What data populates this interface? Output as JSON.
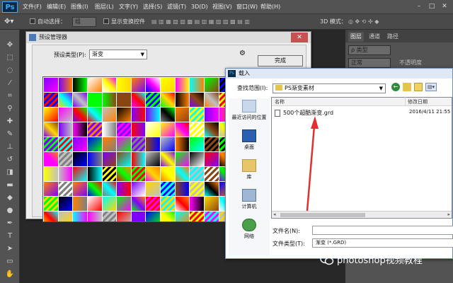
{
  "app": {
    "logo": "Ps"
  },
  "menubar": {
    "items": [
      "文件(F)",
      "编辑(E)",
      "图像(I)",
      "图层(L)",
      "文字(Y)",
      "选择(S)",
      "滤镜(T)",
      "3D(D)",
      "视图(V)",
      "窗口(W)",
      "帮助(H)"
    ]
  },
  "optionsbar": {
    "auto_select_label": "自动选择：",
    "auto_select_value": "组",
    "show_transform_label": "显示变换控件",
    "mode_3d_label": "3D 模式："
  },
  "right_panel": {
    "tabs": [
      "图层",
      "通道",
      "路径"
    ],
    "kind_label": "ρ 类型",
    "blend_label": "正常",
    "opacity_label": "不透明度"
  },
  "preset_manager": {
    "title": "预设管理器",
    "preset_type_label": "预设类型(P):",
    "preset_type_value": "渐变",
    "done_button": "完成",
    "gear_label": "⚙",
    "swatch_count": 140,
    "palette": [
      "#ff0000",
      "#ff8000",
      "#ffff00",
      "#00ff00",
      "#00ffff",
      "#0000ff",
      "#8000ff",
      "#ff00ff",
      "#000000",
      "#ffffff",
      "#7f7f7f",
      "#c0c0c0",
      "#8b4513",
      "#ffd700"
    ]
  },
  "load_dialog": {
    "title": "载入",
    "look_in_label": "查找范围(I):",
    "look_in_value": "PS渐变素材",
    "places": [
      "最近访问的位置",
      "桌面",
      "库",
      "计算机",
      "网络"
    ],
    "columns": {
      "name": "名称",
      "modified": "修改日期"
    },
    "files": [
      {
        "name": "500个超酷渐变.grd",
        "modified": "2016/4/11 21:55"
      }
    ],
    "filename_label": "文件名(N):",
    "filename_value": "",
    "filetype_label": "文件类型(T):",
    "filetype_value": "渐变 (*.GRD)"
  },
  "watermark": {
    "text": "photoshop视频教程"
  },
  "colors": {
    "ps_accent": "#3fa9f5",
    "arrow": "#e03030",
    "ps_chrome": "#535353"
  }
}
